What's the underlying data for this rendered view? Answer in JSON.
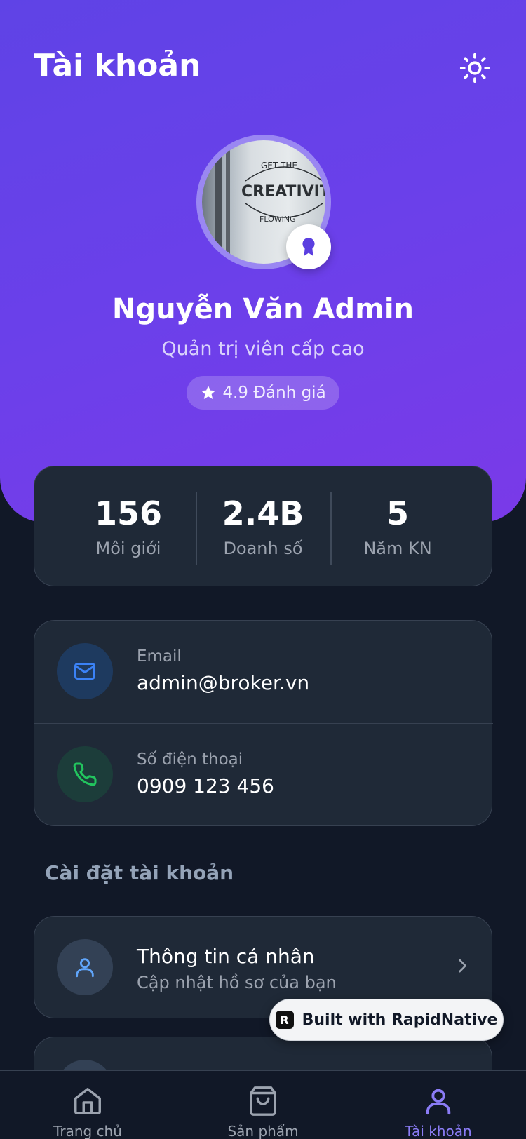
{
  "header": {
    "title": "Tài khoản",
    "theme_icon": "sun-icon"
  },
  "profile": {
    "name": "Nguyễn Văn Admin",
    "role": "Quản trị viên cấp cao",
    "rating": "4.9 Đánh giá",
    "avatar_text": {
      "top": "GET THE",
      "main": "CREATIVIT",
      "bottom": "FLOWING"
    },
    "badge_icon": "award-icon"
  },
  "stats": [
    {
      "value": "156",
      "label": "Môi giới"
    },
    {
      "value": "2.4B",
      "label": "Doanh số"
    },
    {
      "value": "5",
      "label": "Năm KN"
    }
  ],
  "contact": {
    "email_label": "Email",
    "email_value": "admin@broker.vn",
    "phone_label": "Số điện thoại",
    "phone_value": "0909 123 456"
  },
  "settings": {
    "section_title": "Cài đặt tài khoản",
    "items": [
      {
        "title": "Thông tin cá nhân",
        "subtitle": "Cập nhật hồ sơ của bạn",
        "icon": "user-icon"
      }
    ]
  },
  "promo": {
    "label": "Built with RapidNative"
  },
  "tabs": [
    {
      "label": "Trang chủ",
      "icon": "home-icon"
    },
    {
      "label": "Sản phẩm",
      "icon": "shopping-bag-icon"
    },
    {
      "label": "Tài khoản",
      "icon": "user-icon",
      "active": true
    }
  ],
  "colors": {
    "accent": "#6b40ea",
    "background": "#111827",
    "card": "#1f2937",
    "email_icon": "#3b82f6",
    "phone_icon": "#22c55e",
    "active_tab": "#8b7cf6"
  }
}
